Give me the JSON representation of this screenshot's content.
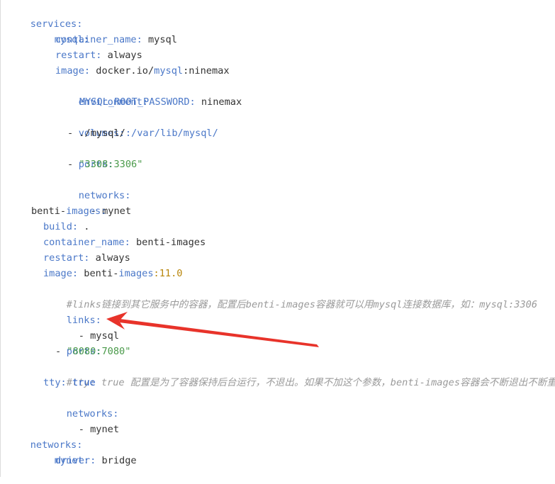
{
  "yaml": {
    "services_key": "services:",
    "mysql_key": "mysql:",
    "container_name_key": "container_name:",
    "mysql_container_name": "mysql",
    "restart_key": "restart:",
    "mysql_restart": "always",
    "image_key": "image:",
    "mysql_image_a": "docker.io/",
    "mysql_image_b": "mysql",
    "mysql_image_c": ":ninemax",
    "environment_key": "environment:",
    "env_var_key": "MYSQL_ROOT_PASSWORD:",
    "env_var_value": "ninemax",
    "volumes_key": "volumes:",
    "volume_dash": "- ./mysql/",
    "volume_rest": ":/var/lib/mysql/",
    "ports_key": "ports:",
    "mysql_port_dash": "- ",
    "mysql_port": "\"3308:3306\"",
    "networks_key": "networks:",
    "mysql_network": "- mynet",
    "benti_key_a": "benti-",
    "benti_key_b": "images:",
    "build_key": "build:",
    "build_value": ".",
    "benti_container_name": "benti-images",
    "benti_restart": "always",
    "benti_image_a": "benti-",
    "benti_image_b": "images",
    "benti_image_c": ":11.0",
    "comment_links": "#links链接到其它服务中的容器，配置后benti-images容器就可以用mysql连接数据库，如：mysql:3306",
    "links_key": "links:",
    "links_value": "- mysql",
    "benti_port_dash": "- ",
    "benti_port": "\"8080:7080\"",
    "comment_tty": "#tty: true 配置是为了容器保持后台运行，不退出。如果不加这个参数，benti-images容器会不断退出不断重启",
    "tty_key": "tty:",
    "tty_value": "true",
    "benti_network": "- mynet",
    "top_networks_key": "networks:",
    "mynet_key": "mynet:",
    "driver_key": "driver:",
    "driver_value": "bridge"
  },
  "annotation": {
    "arrow_color": "#e8332a"
  }
}
